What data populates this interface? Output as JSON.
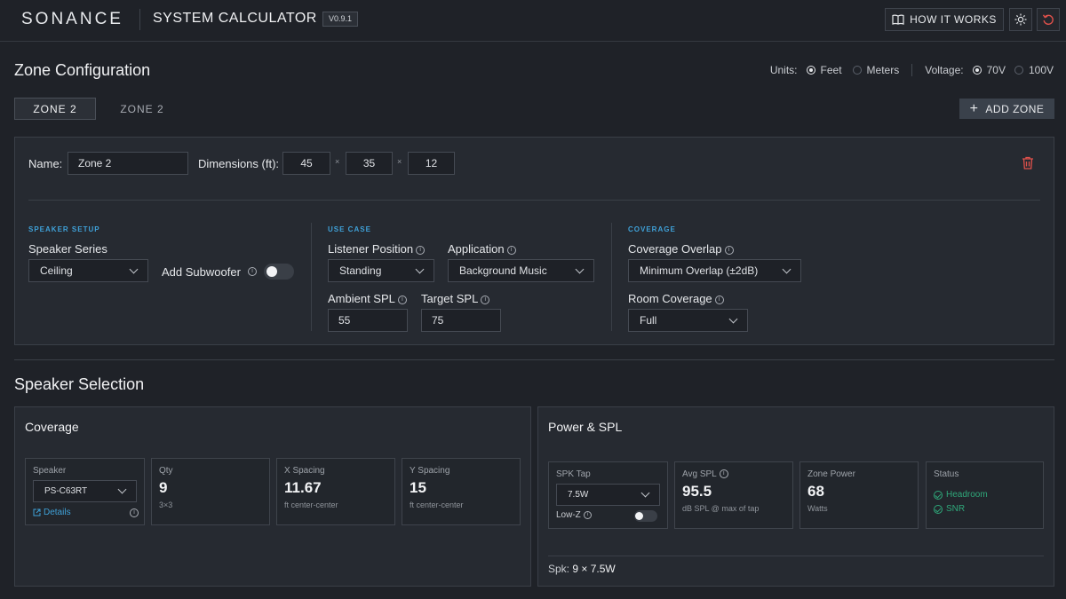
{
  "header": {
    "brand": "SONANCE",
    "title": "SYSTEM CALCULATOR",
    "version": "V0.9.1",
    "how_it_works": "HOW IT WORKS"
  },
  "zone_config": {
    "title": "Zone Configuration",
    "units_label": "Units:",
    "units": [
      {
        "label": "Feet",
        "selected": true
      },
      {
        "label": "Meters",
        "selected": false
      }
    ],
    "voltage_label": "Voltage:",
    "voltages": [
      {
        "label": "70V",
        "selected": true
      },
      {
        "label": "100V",
        "selected": false
      }
    ],
    "tabs": [
      {
        "label": "ZONE 2",
        "active": true
      },
      {
        "label": "ZONE 2",
        "active": false
      }
    ],
    "add_zone": "ADD ZONE",
    "name_label": "Name:",
    "name_value": "Zone 2",
    "dimensions_label": "Dimensions (ft):",
    "dimensions": [
      "45",
      "35",
      "12"
    ],
    "dim_sep": "×",
    "speaker_setup": {
      "title": "SPEAKER SETUP",
      "series_label": "Speaker Series",
      "series_value": "Ceiling",
      "subwoofer_label": "Add Subwoofer",
      "subwoofer_on": false
    },
    "use_case": {
      "title": "USE CASE",
      "listener_label": "Listener Position",
      "listener_value": "Standing",
      "application_label": "Application",
      "application_value": "Background Music",
      "ambient_label": "Ambient SPL",
      "ambient_value": "55",
      "target_label": "Target SPL",
      "target_value": "75"
    },
    "coverage": {
      "title": "COVERAGE",
      "overlap_label": "Coverage Overlap",
      "overlap_value": "Minimum Overlap (±2dB)",
      "room_label": "Room Coverage",
      "room_value": "Full"
    }
  },
  "speaker_selection": {
    "title": "Speaker Selection",
    "coverage_card": {
      "title": "Coverage",
      "speaker_label": "Speaker",
      "speaker_value": "PS-C63RT",
      "details_link": "Details",
      "qty_label": "Qty",
      "qty_value": "9",
      "qty_sub": "3×3",
      "x_label": "X Spacing",
      "x_value": "11.67",
      "x_sub": "ft center-center",
      "y_label": "Y Spacing",
      "y_value": "15",
      "y_sub": "ft center-center"
    },
    "power_card": {
      "title": "Power & SPL",
      "tap_label": "SPK Tap",
      "tap_value": "7.5W",
      "lowz_label": "Low-Z",
      "avg_label": "Avg SPL",
      "avg_value": "95.5",
      "avg_sub": "dB SPL @ max of tap",
      "zone_power_label": "Zone Power",
      "zone_power_value": "68",
      "zone_power_sub": "Watts",
      "status_label": "Status",
      "status_items": [
        "Headroom",
        "SNR"
      ],
      "spk_summary_label": "Spk:",
      "spk_summary_value": "9 × 7.5W"
    }
  },
  "colors": {
    "accent": "#3fa1d8",
    "ok": "#2fa87a",
    "danger": "#e0514b"
  }
}
